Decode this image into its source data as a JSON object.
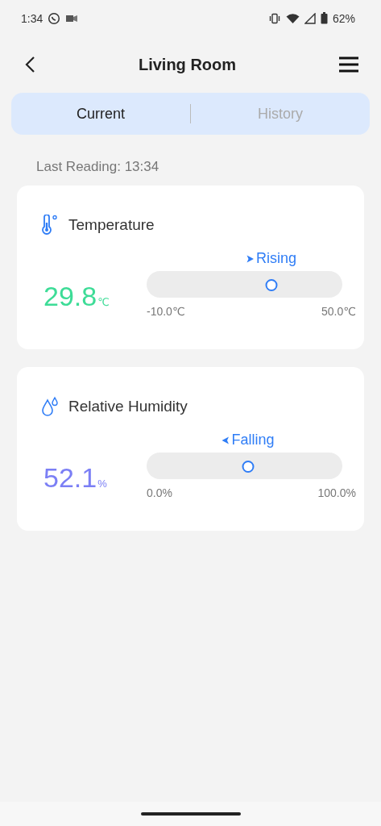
{
  "status_bar": {
    "time": "1:34",
    "battery": "62%"
  },
  "header": {
    "title": "Living Room"
  },
  "tabs": [
    {
      "label": "Current",
      "selected": true
    },
    {
      "label": "History",
      "selected": false
    }
  ],
  "last_reading": "Last Reading: 13:34",
  "sensors": [
    {
      "kind": "temperature",
      "name": "Temperature",
      "value": "29.8",
      "unit": "℃",
      "color": "#3ddc97",
      "trend": {
        "kind": "rising",
        "label": "Rising"
      },
      "level": 0.66,
      "min": "-10.0℃",
      "max": "50.0℃"
    },
    {
      "kind": "humidity",
      "name": "Relative Humidity",
      "value": "52.1",
      "unit": "%",
      "color": "#7b7ff5",
      "trend": {
        "kind": "falling",
        "label": "Falling"
      },
      "level": 0.52,
      "min": "0.0%",
      "max": "100.0%"
    }
  ]
}
